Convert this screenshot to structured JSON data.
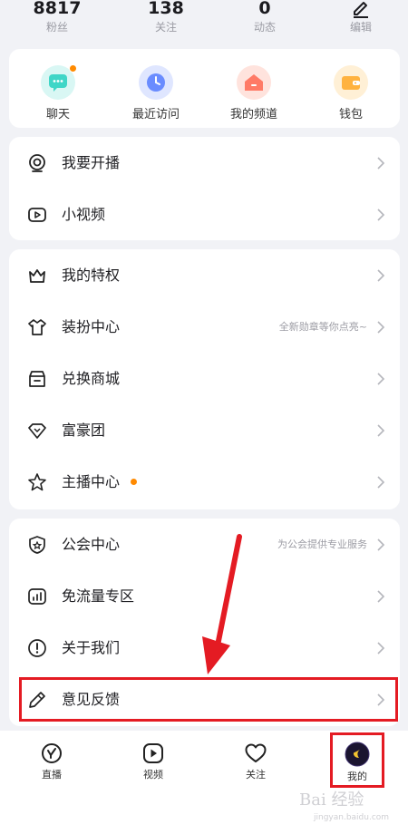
{
  "stats": {
    "fans": {
      "value": "8817",
      "label": "粉丝"
    },
    "follow": {
      "value": "138",
      "label": "关注"
    },
    "moments": {
      "value": "0",
      "label": "动态"
    },
    "edit": {
      "label": "编辑"
    }
  },
  "quick_actions": [
    {
      "label": "聊天",
      "icon": "chat-icon",
      "color": "#3fd6c7"
    },
    {
      "label": "最近访问",
      "icon": "clock-icon",
      "color": "#6a8cff"
    },
    {
      "label": "我的频道",
      "icon": "home-icon",
      "color": "#ff7a66"
    },
    {
      "label": "钱包",
      "icon": "wallet-icon",
      "color": "#ffb23f"
    }
  ],
  "menu_group1": [
    {
      "label": "我要开播",
      "icon": "broadcast-icon"
    },
    {
      "label": "小视频",
      "icon": "video-icon"
    }
  ],
  "menu_group2": [
    {
      "label": "我的特权",
      "icon": "crown-icon",
      "sub": ""
    },
    {
      "label": "装扮中心",
      "icon": "shirt-icon",
      "sub": "全新勋章等你点亮~"
    },
    {
      "label": "兑换商城",
      "icon": "store-icon",
      "sub": ""
    },
    {
      "label": "富豪团",
      "icon": "diamond-icon",
      "sub": ""
    },
    {
      "label": "主播中心",
      "icon": "star-icon",
      "sub": ""
    }
  ],
  "menu_group3": [
    {
      "label": "公会中心",
      "icon": "shield-icon",
      "sub": "为公会提供专业服务"
    },
    {
      "label": "免流量专区",
      "icon": "signal-icon",
      "sub": ""
    },
    {
      "label": "关于我们",
      "icon": "info-icon",
      "sub": ""
    },
    {
      "label": "意见反馈",
      "icon": "pencil-icon",
      "sub": ""
    }
  ],
  "tabs": [
    {
      "label": "直播",
      "icon": "live-icon"
    },
    {
      "label": "视频",
      "icon": "play-icon"
    },
    {
      "label": "关注",
      "icon": "heart-icon"
    },
    {
      "label": "我的",
      "icon": "profile-avatar-icon"
    }
  ],
  "watermark": {
    "main": "Bai 经验",
    "sub": "jingyan.baidu.com"
  },
  "colors": {
    "accent_orange": "#ff8a00",
    "annotation_red": "#e41b23"
  }
}
